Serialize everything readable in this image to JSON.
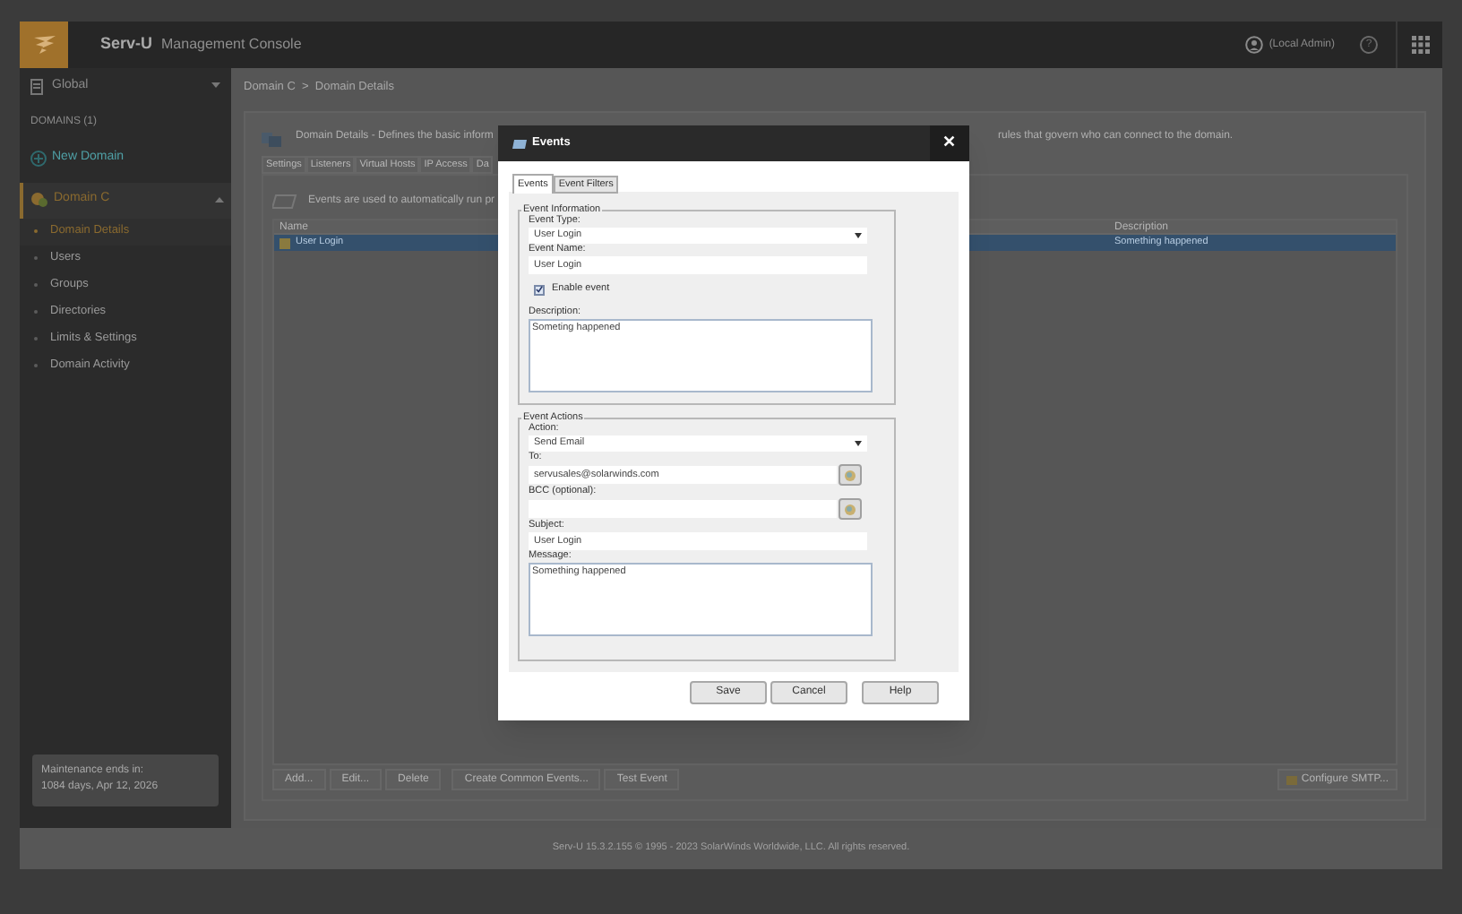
{
  "header": {
    "product": "Serv-U",
    "subtitle": "Management Console",
    "user": "(Local Admin)",
    "help": "?"
  },
  "sidebar": {
    "global": "Global",
    "domains_heading": "DOMAINS (1)",
    "new_domain": "New Domain",
    "domain": {
      "label": "Domain C",
      "expanded": true
    },
    "items": [
      {
        "label": "Domain Details",
        "selected": true
      },
      {
        "label": "Users",
        "selected": false
      },
      {
        "label": "Groups",
        "selected": false
      },
      {
        "label": "Directories",
        "selected": false
      },
      {
        "label": "Limits & Settings",
        "selected": false
      },
      {
        "label": "Domain Activity",
        "selected": false
      }
    ],
    "maintenance": [
      "Maintenance ends in:",
      "1084 days, Apr 12, 2026"
    ]
  },
  "breadcrumb": "Domain C  >  Domain Details",
  "page": {
    "description_left": "Domain Details - Defines the basic inform",
    "description_right": "rules that govern who can connect to the domain.",
    "tabs": [
      {
        "label": "Settings",
        "selected": false
      },
      {
        "label": "Listeners",
        "selected": false
      },
      {
        "label": "Virtual Hosts",
        "selected": false
      },
      {
        "label": "IP Access",
        "selected": false
      },
      {
        "label": "Da",
        "selected": false
      }
    ],
    "events_note": "Events are used to automatically run pr",
    "table": {
      "columns": [
        "Name",
        "Description"
      ],
      "rows": [
        {
          "name": "User Login",
          "description": "Something happened",
          "selected": true
        }
      ]
    },
    "buttons": [
      "Add...",
      "Edit...",
      "Delete",
      "Create Common Events...",
      "Test Event"
    ],
    "smtp_button": "Configure SMTP..."
  },
  "footer": "Serv-U 15.3.2.155 © 1995 - 2023 SolarWinds Worldwide, LLC. All rights reserved.",
  "dialog": {
    "title": "Events",
    "close": "✕",
    "tabs": [
      {
        "label": "Events",
        "selected": true
      },
      {
        "label": "Event Filters",
        "selected": false
      }
    ],
    "info": {
      "legend": "Event Information",
      "type_label": "Event Type:",
      "type_value": "User Login",
      "name_label": "Event Name:",
      "name_value": "User Login",
      "enable_label": "Enable event",
      "enabled": true,
      "description_label": "Description:",
      "description_value": "Someting happened"
    },
    "actions": {
      "legend": "Event Actions",
      "action_label": "Action:",
      "action_value": "Send Email",
      "to_label": "To:",
      "to_value": "servusales@solarwinds.com",
      "bcc_label": "BCC (optional):",
      "subject_label": "Subject:",
      "subject_value": "User Login",
      "message_label": "Message:",
      "message_value": "Something happened"
    },
    "buttons": [
      "Save",
      "Cancel",
      "Help"
    ]
  }
}
